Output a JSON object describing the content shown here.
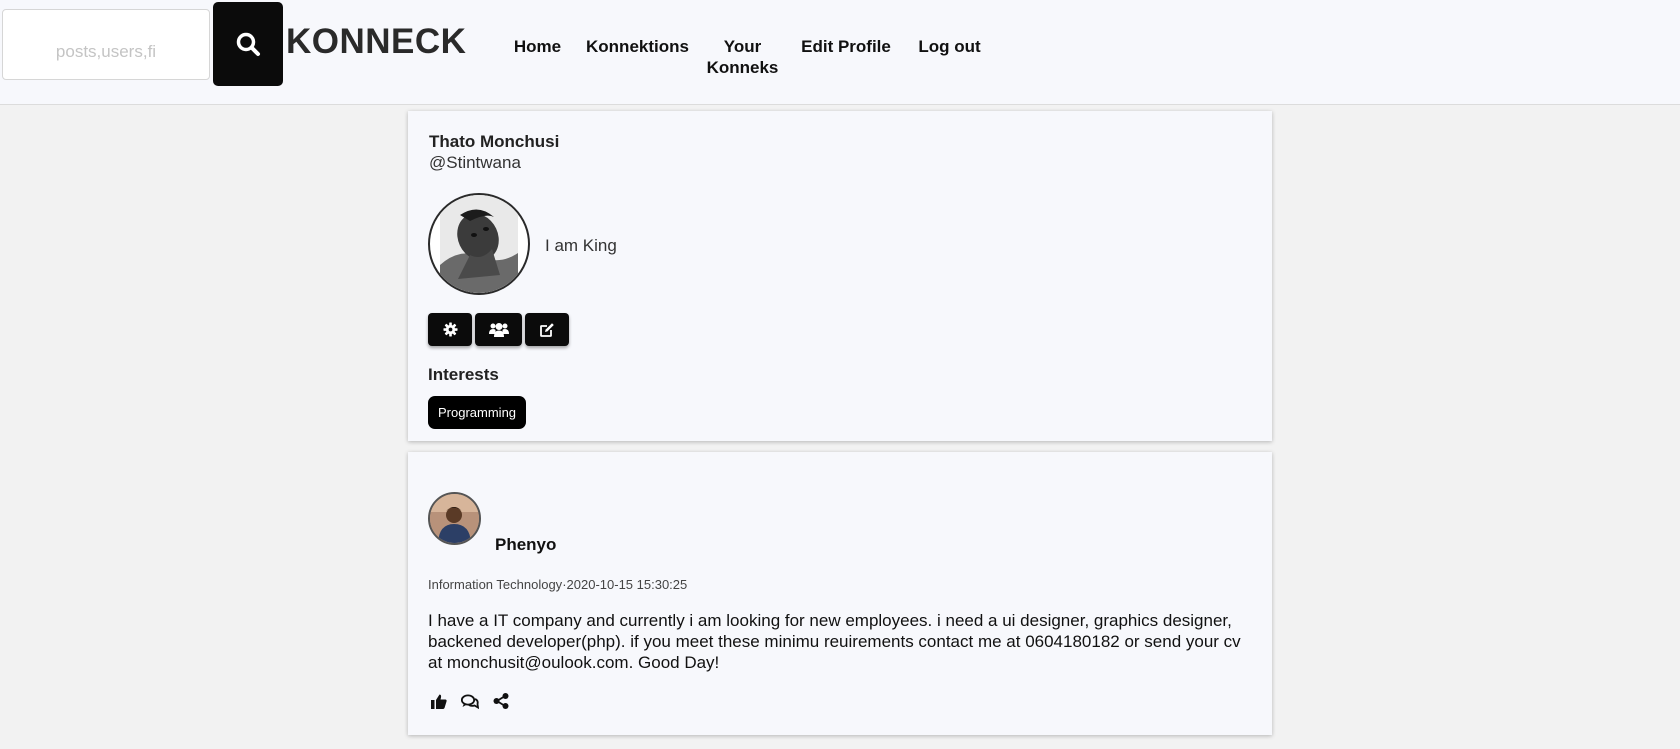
{
  "search": {
    "placeholder": "posts,users,fi"
  },
  "brand": "KONNECK",
  "nav": {
    "home": "Home",
    "konnektions": "Konnektions",
    "your_konneks_line1": "Your",
    "your_konneks_line2": "Konneks",
    "edit_profile": "Edit Profile",
    "log_out": "Log out"
  },
  "profile": {
    "name": "Thato Monchusi",
    "handle": "@Stintwana",
    "bio": "I am King",
    "actions": [
      "gear-icon",
      "users-icon",
      "edit-icon"
    ],
    "interests_heading": "Interests",
    "interests": [
      "Programming"
    ]
  },
  "post": {
    "author": "Phenyo",
    "category": "Information Technology",
    "separator": "·",
    "timestamp": "2020-10-15 15:30:25",
    "body": "I have a IT company and currently i am looking for new employees. i need a ui designer, graphics designer, backened developer(php). if you meet these minimu reuirements contact me at 0604180182 or send your cv at monchusit@oulook.com. Good Day!",
    "actions": [
      "thumbs-up-icon",
      "comments-icon",
      "share-icon"
    ]
  },
  "colors": {
    "accent": "#0b0b0b",
    "card_bg": "#f7f8fc",
    "page_bg": "#f2f2f2"
  }
}
